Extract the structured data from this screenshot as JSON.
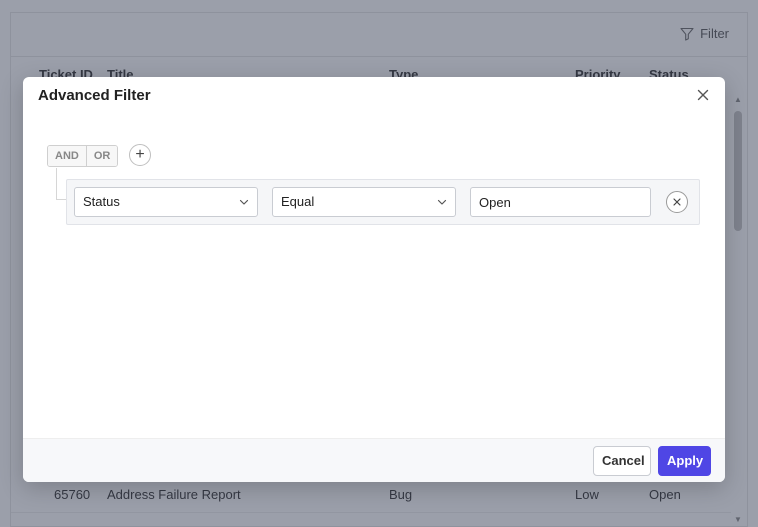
{
  "toolbar": {
    "filter_label": "Filter"
  },
  "grid": {
    "columns": [
      "Ticket ID",
      "Title",
      "Type",
      "Priority",
      "Status"
    ],
    "rows": [
      {
        "id": "65760",
        "title": "Address Failure Report",
        "type": "Bug",
        "priority": "Low",
        "status": "Open"
      }
    ]
  },
  "modal": {
    "title": "Advanced Filter",
    "logic": {
      "and_label": "AND",
      "or_label": "OR",
      "add_symbol": "+"
    },
    "condition": {
      "field": "Status",
      "operator": "Equal",
      "value": "Open"
    },
    "cancel_label": "Cancel",
    "apply_label": "Apply"
  },
  "colors": {
    "accent": "#4f46e5",
    "overlay": "#373f55"
  }
}
